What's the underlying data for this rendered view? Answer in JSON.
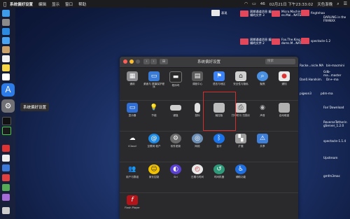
{
  "menubar": {
    "app": "系统偏好设置",
    "items": [
      "编辑",
      "显示",
      "窗口",
      "帮助"
    ],
    "status_date": "02月21日 下午23:33:02",
    "user": "天色渐晚",
    "battery_pct": "46"
  },
  "dock_tooltip": "系统偏好设置",
  "desktop": [
    {
      "label": "表现"
    },
    {
      "label": "周期通道消息 编辑的文件 3"
    },
    {
      "label": "Micro.Machin es.Mal...NATED"
    },
    {
      "label": "fingtnhao"
    },
    {
      "label": "DARLING in the FRANXX"
    },
    {
      "label": "周期通道消息 编辑的文件 2"
    },
    {
      "label": "Fox.The.King. doms.M...NATED"
    },
    {
      "label": "spectacle-1.2"
    },
    {
      "label": "Rocke...nicle.MA"
    },
    {
      "label": "bin-macmini"
    },
    {
      "label": "Dan0.Handsim."
    },
    {
      "label": "Dn+-ma"
    },
    {
      "label": "pigeon3"
    },
    {
      "label": "pdm-ma"
    },
    {
      "label": "Gdb-ma...master"
    },
    {
      "label": "Fan’Download"
    },
    {
      "label": "ReverseTetherin gServer_1.2.0"
    },
    {
      "label": "spectacle-1.1.4"
    },
    {
      "label": "Upstream"
    },
    {
      "label": "gmfm3mac"
    }
  ],
  "window": {
    "title": "系统偏好设置",
    "search_placeholder": "搜索",
    "grid_button": "⊞",
    "rows": [
      [
        {
          "label": "通用",
          "icon": "general-icon",
          "color": "#8e8e93"
        },
        {
          "label": "桌面与 屏幕保护程序",
          "icon": "desktop-icon",
          "color": "#3a7bd5"
        },
        {
          "label": "程序坞",
          "icon": "dock-icon",
          "color": "#333"
        },
        {
          "label": "调度中心",
          "icon": "mission-control-icon",
          "color": "#5a5a5a"
        },
        {
          "label": "语言与地区",
          "icon": "globe-flag-icon",
          "color": "#3b82f6"
        },
        {
          "label": "安全性与隐私",
          "icon": "house-lock-icon",
          "color": "#d0d0d0"
        },
        {
          "label": "聚焦",
          "icon": "spotlight-icon",
          "color": "#4a90e2"
        },
        {
          "label": "通知",
          "icon": "notifications-icon",
          "color": "#e8e8e8"
        }
      ],
      [
        {
          "label": "显示器",
          "icon": "display-icon",
          "color": "#2f6fd6"
        },
        {
          "label": "节能",
          "icon": "bulb-icon",
          "color": "#f4d03f"
        },
        {
          "label": "键盘",
          "icon": "keyboard-icon",
          "color": "#cfcfcf"
        },
        {
          "label": "鼠标",
          "icon": "mouse-icon",
          "color": "#e0e0e0"
        },
        {
          "label": "触控板",
          "icon": "trackpad-icon",
          "color": "#bdbdbd"
        },
        {
          "label": "打印机与 扫描仪",
          "icon": "printer-icon",
          "color": "#cccccc"
        },
        {
          "label": "声音",
          "icon": "speaker-icon",
          "color": "#9a9a9a"
        },
        {
          "label": "启动磁盘",
          "icon": "disk-icon",
          "color": "#b0b0b0"
        }
      ],
      [
        {
          "label": "iCloud",
          "icon": "icloud-icon",
          "color": "#ffffff"
        },
        {
          "label": "互联网 帐户",
          "icon": "at-icon",
          "color": "#1e88e5"
        },
        {
          "label": "软件更新",
          "icon": "gear-update-icon",
          "color": "#6b6b6b"
        },
        {
          "label": "网络",
          "icon": "network-icon",
          "color": "#6e8fb5"
        },
        {
          "label": "蓝牙",
          "icon": "bluetooth-icon",
          "color": "#1a73e8"
        },
        {
          "label": "扩展",
          "icon": "puzzle-icon",
          "color": "#9e9e9e"
        },
        {
          "label": "共享",
          "icon": "sharing-icon",
          "color": "#3f7fd8"
        }
      ],
      [
        {
          "label": "用户与群组",
          "icon": "users-icon",
          "color": "#7a7a7a"
        },
        {
          "label": "家长控制",
          "icon": "parental-icon",
          "color": "#f2c200"
        },
        {
          "label": "Siri",
          "icon": "siri-icon",
          "color": "#5b3fd1"
        },
        {
          "label": "日期与时间",
          "icon": "clock-icon",
          "color": "#e8e8e8"
        },
        {
          "label": "时间机器",
          "icon": "time-machine-icon",
          "color": "#2e9a7a"
        },
        {
          "label": "辅助功能",
          "icon": "accessibility-icon",
          "color": "#1f6fe0"
        }
      ],
      [
        {
          "label": "Flash Player",
          "icon": "flash-icon",
          "color": "#b3141a"
        }
      ]
    ]
  }
}
